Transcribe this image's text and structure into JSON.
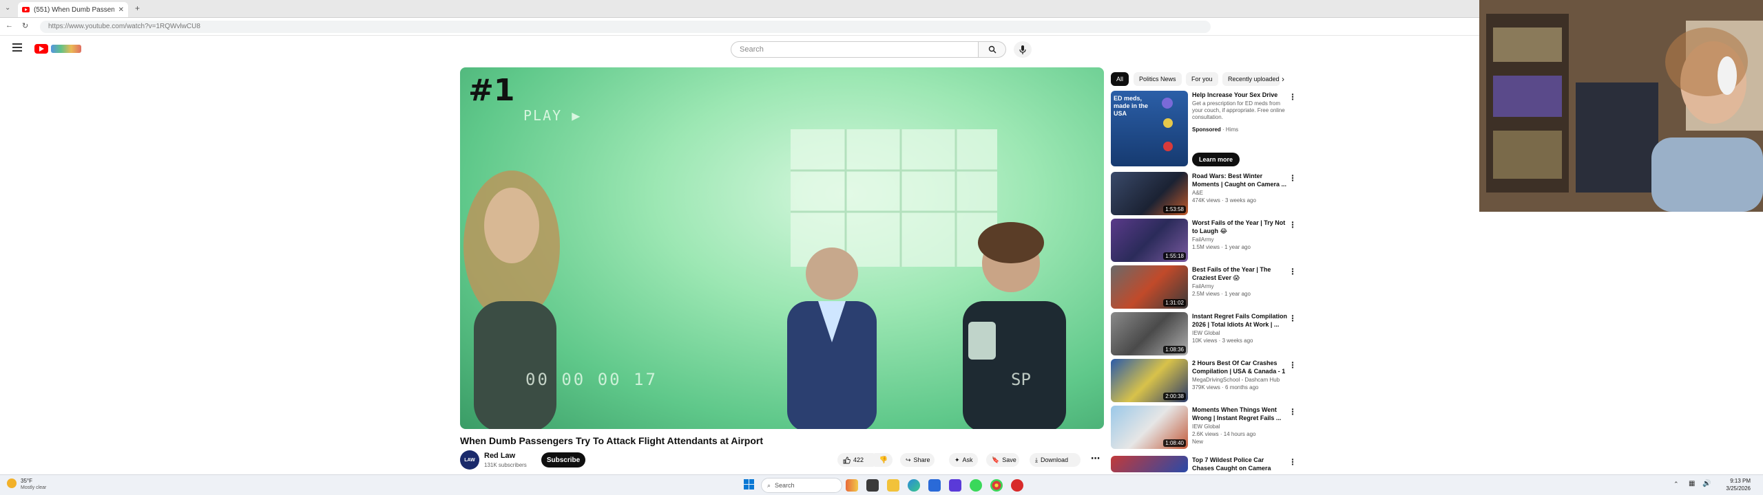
{
  "browser": {
    "tab_title": "(551) When Dumb Passenger...",
    "url": "https://www.youtube.com/watch?v=1RQWvlwCU8"
  },
  "header": {
    "search_placeholder": "Search"
  },
  "video": {
    "overlay_number": "#1",
    "overlay_play": "PLAY ▶",
    "overlay_timecode": "00 00 00 17",
    "overlay_corner": "SP",
    "title": "When Dumb Passengers Try To Attack Flight Attendants at Airport",
    "channel": "Red Law",
    "channel_avatar_text": "LAW",
    "subscribers": "131K subscribers",
    "subscribe_label": "Subscribe",
    "likes": "422",
    "share_label": "Share",
    "ask_label": "Ask",
    "save_label": "Save",
    "download_label": "Download"
  },
  "chips": [
    "All",
    "Politics News",
    "For you",
    "Recently uploaded"
  ],
  "ad": {
    "title": "Help Increase Your Sex Drive",
    "description": "Get a prescription for ED meds from your couch, if appropriate. Free online consultation.",
    "sponsored": "Sponsored",
    "advertiser": "Hims",
    "cta": "Learn more",
    "thumb_text": "ED meds, made in the USA"
  },
  "recommendations": [
    {
      "title": "Road Wars: Best Winter Moments | Caught on Camera ...",
      "channel": "A&E",
      "meta": "474K views · 3 weeks ago",
      "duration": "1:53:58"
    },
    {
      "title": "Worst Fails of the Year | Try Not to Laugh 😂",
      "channel": "FailArmy",
      "meta": "1.5M views · 1 year ago",
      "duration": "1:55:18"
    },
    {
      "title": "Best Fails of the Year | The Craziest Ever 😱",
      "channel": "FailArmy",
      "meta": "2.5M views · 1 year ago",
      "duration": "1:31:02"
    },
    {
      "title": "Instant Regret Fails Compilation 2026 | Total Idiots At Work | ...",
      "channel": "IEW Global",
      "meta": "10K views · 3 weeks ago",
      "duration": "1:08:36"
    },
    {
      "title": "2 Hours Best Of Car Crashes Compilation | USA & Canada - 1",
      "channel": "MegaDrivingSchool - Dashcam Hub",
      "meta": "379K views · 6 months ago",
      "duration": "2:00:38"
    },
    {
      "title": "Moments When Things Went Wrong | Instant Regret Fails ...",
      "channel": "IEW Global",
      "meta": "2.6K views · 14 hours ago",
      "meta2": "New",
      "duration": "1:08:40"
    },
    {
      "title": "Top 7 Wildest Police Car Chases Caught on Camera",
      "channel": "",
      "meta": "",
      "duration": ""
    }
  ],
  "taskbar": {
    "weather_temp": "35°F",
    "weather_desc": "Mostly clear",
    "search_label": "Search",
    "time": "9:13 PM",
    "date": "3/25/2026"
  },
  "colors": {
    "brand_red": "#ff0000",
    "video_tint": "#9ce7b3",
    "subscribe_bg": "#0f0f0f"
  }
}
